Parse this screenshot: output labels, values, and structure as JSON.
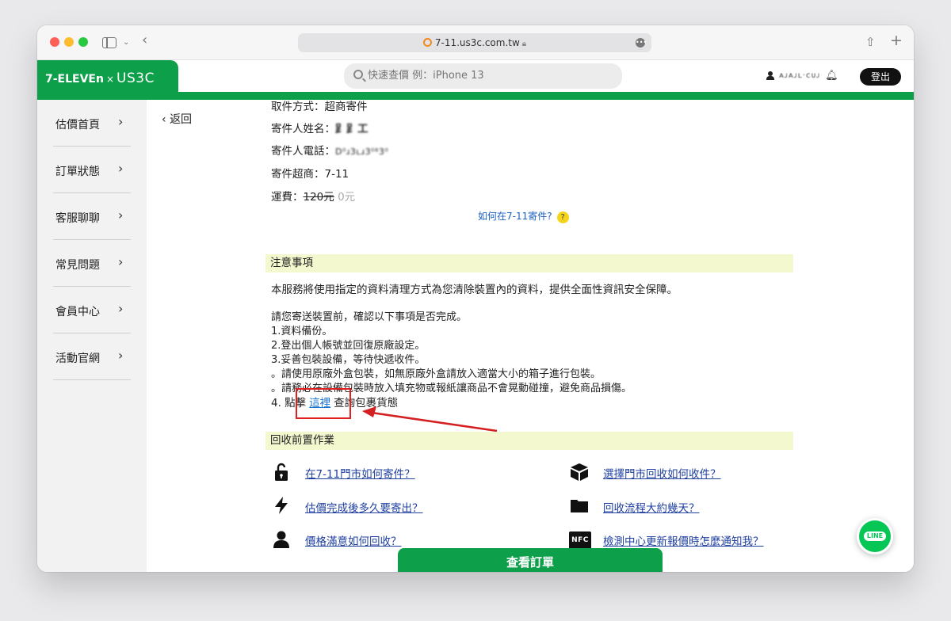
{
  "browser": {
    "url": "7-11.us3c.com.tw"
  },
  "header": {
    "brand_left": "7-ELEVEn",
    "brand_sep": "×",
    "brand_right": "US3C",
    "search_placeholder": "快速查價 例：iPhone 13",
    "user_name": "ᴀᴊᴀᴊʟ·ᴄᴜᴊ",
    "logout": "登出"
  },
  "sidebar": {
    "items": [
      {
        "label": "估價首頁"
      },
      {
        "label": "訂單狀態"
      },
      {
        "label": "客服聊聊"
      },
      {
        "label": "常見問題"
      },
      {
        "label": "會員中心"
      },
      {
        "label": "活動官網"
      }
    ]
  },
  "main": {
    "back": "返回",
    "pickup_method": "取件方式：超商寄件",
    "sender_name_label": "寄件人姓名：",
    "sender_name_value": "⻊⻊⼯",
    "sender_phone_label": "寄件人電話：",
    "sender_phone_value": "D⁰ɹ3ʟɹ3⁰⁸3⁰",
    "sender_store": "寄件超商：7-11",
    "shipping_label": "運費：",
    "shipping_original": "120元",
    "shipping_final": "0元",
    "help_link": "如何在7-11寄件?",
    "help_badge": "?",
    "notice_title": "注意事項",
    "notice_text": "本服務將使用指定的資料清理方式為您清除裝置內的資料，提供全面性資訊安全保障。",
    "steps_intro": "請您寄送裝置前，確認以下事項是否完成。",
    "step1": "1.資料備份。",
    "step2": "2.登出個人帳號並回復原廠設定。",
    "step3": "3.妥善包裝設備，等待快遞收件。",
    "step3a": "。請使用原廠外盒包裝，如無原廠外盒請放入適當大小的箱子進行包裝。",
    "step3b": "。請務必在設備包裝時放入填充物或報紙讓商品不會晃動碰撞，避免商品損傷。",
    "step4_prefix": "4. 點擊",
    "step4_link": "這裡",
    "step4_suffix": "查詢包裹貨態",
    "prep_title": "回收前置作業",
    "faq": [
      {
        "label": "在7-11門市如何寄件？",
        "icon": "unlock-icon"
      },
      {
        "label": "選擇門市回收如何收件？",
        "icon": "box-icon"
      },
      {
        "label": "估價完成後多久要寄出？",
        "icon": "bolt-icon"
      },
      {
        "label": "回收流程大約幾天？",
        "icon": "folder-icon"
      },
      {
        "label": "價格滿意如何回收？",
        "icon": "user-icon"
      },
      {
        "label": "檢測中心更新報價時怎麼通知我？",
        "icon": "nfc-icon"
      }
    ],
    "nfc_text": "NFC",
    "view_order": "查看訂單"
  },
  "line_button": "LINE",
  "colors": {
    "brand_green": "#0e9f4a",
    "link_blue": "#1e3fa0",
    "section_bg": "#f3f8cf",
    "annotation_red": "#e02020"
  }
}
